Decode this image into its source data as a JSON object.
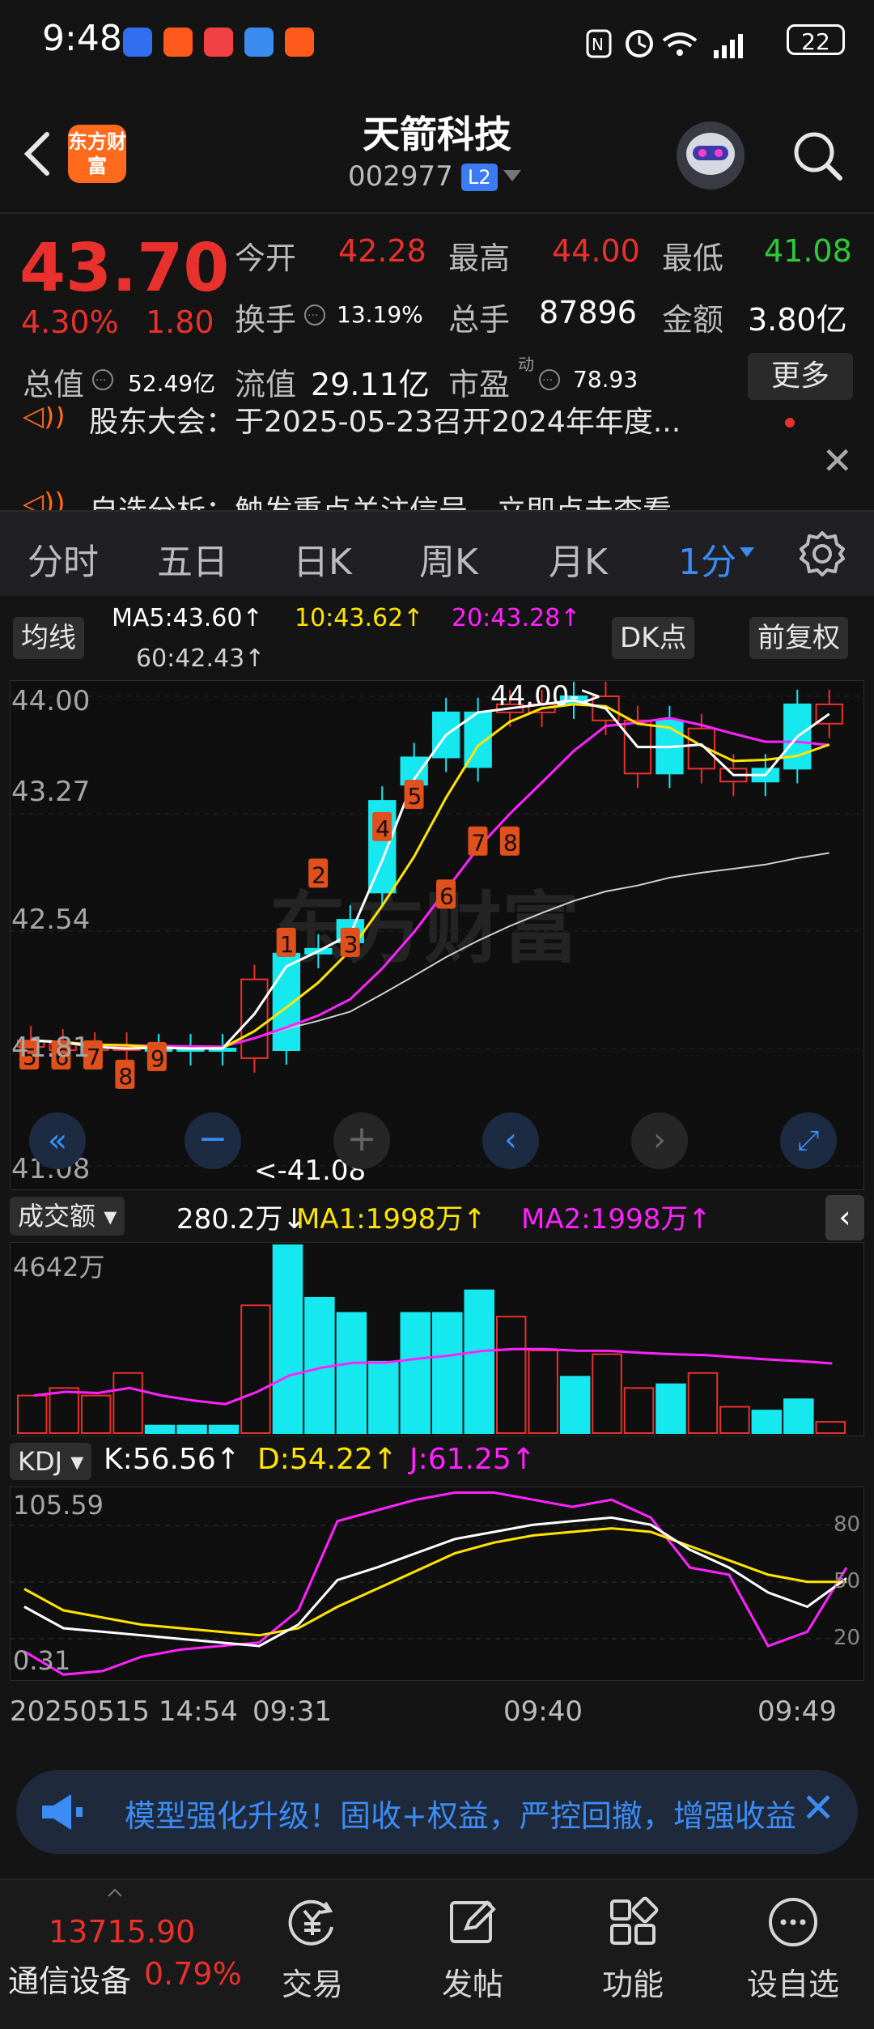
{
  "status_bar": {
    "time": "9:48",
    "battery": "22"
  },
  "header": {
    "back_icon": "chevron-left-icon",
    "logo_text": "东方财富",
    "stock_name": "天箭科技",
    "stock_code": "002977",
    "level_badge": "L2",
    "search_icon": "search-icon"
  },
  "quote": {
    "price": "43.70",
    "change_pct": "4.30%",
    "change_amt": "1.80",
    "open_label": "今开",
    "open_value": "42.28",
    "high_label": "最高",
    "high_value": "44.00",
    "low_label": "最低",
    "low_value": "41.08",
    "turnover_label": "换手",
    "turnover_value": "13.19%",
    "volume_label": "总手",
    "volume_value": "87896",
    "amount_label": "金额",
    "amount_value": "3.80亿",
    "mcap_label": "总值",
    "mcap_value": "52.49亿",
    "float_label": "流值",
    "float_value": "29.11亿",
    "pe_label": "市盈",
    "pe_sup": "动",
    "pe_value": "78.93",
    "more_label": "更多"
  },
  "news": {
    "line1": "股东大会：于2025-05-23召开2024年年度...",
    "line2": "自选分析：触发重点关注信号，立即点击查看"
  },
  "tabs": {
    "items": [
      "分时",
      "五日",
      "日K",
      "周K",
      "月K"
    ],
    "active": "1分"
  },
  "ma": {
    "chip": "均线",
    "ma5": "MA5:43.60↑",
    "ma10": "10:43.62↑",
    "ma20": "20:43.28↑",
    "ma60": "60:42.43↑",
    "dk_label": "DK点",
    "adjust_label": "前复权"
  },
  "kchart": {
    "y_labels": [
      "44.00",
      "43.27",
      "42.54",
      "41.81",
      "41.08"
    ],
    "high_marker": "44.00->",
    "low_marker": "<-41.08",
    "td_labels_red": [
      "1",
      "2",
      "3",
      "4",
      "5",
      "6",
      "7",
      "8"
    ],
    "td_labels_low": [
      "5",
      "6",
      "7",
      "8",
      "9"
    ]
  },
  "volume": {
    "chip": "成交额",
    "current": "280.2万↓",
    "ma1": "MA1:1998万↑",
    "ma2": "MA2:1998万↑",
    "y_top": "4642万"
  },
  "kdj": {
    "chip": "KDJ",
    "k": "K:56.56↑",
    "d": "D:54.22↑",
    "j": "J:61.25↑",
    "y_top": "105.59",
    "y_bottom": "0.31",
    "levels": [
      "80",
      "50",
      "20"
    ]
  },
  "time_axis": {
    "start": "20250515 14:54",
    "t1": "09:31",
    "t2": "09:40",
    "t3": "09:49"
  },
  "banner": {
    "text": "模型强化升级！固收+权益，严控回撤，增强收益"
  },
  "bottom_nav": {
    "index_value": "13715.90",
    "index_name": "通信设备",
    "index_change": "0.79%",
    "items": [
      "交易",
      "发帖",
      "功能",
      "设自选"
    ]
  },
  "chart_data": {
    "type": "candlestick",
    "price_range": [
      41.08,
      44.0
    ],
    "candles": [
      {
        "o": 41.82,
        "c": 41.86,
        "up": false
      },
      {
        "o": 41.8,
        "c": 41.84,
        "up": false
      },
      {
        "o": 41.82,
        "c": 41.8,
        "up": false
      },
      {
        "o": 41.8,
        "c": 41.82,
        "up": false
      },
      {
        "o": 41.81,
        "c": 41.81,
        "up": true
      },
      {
        "o": 41.81,
        "c": 41.81,
        "up": true
      },
      {
        "o": 41.81,
        "c": 41.81,
        "up": true
      },
      {
        "o": 41.75,
        "c": 42.24,
        "up": false
      },
      {
        "o": 41.8,
        "c": 42.4,
        "up": true
      },
      {
        "o": 42.4,
        "c": 42.43,
        "up": true
      },
      {
        "o": 42.47,
        "c": 42.61,
        "up": true
      },
      {
        "o": 42.78,
        "c": 43.35,
        "up": true
      },
      {
        "o": 43.45,
        "c": 43.62,
        "up": true
      },
      {
        "o": 43.62,
        "c": 43.9,
        "up": true
      },
      {
        "o": 43.56,
        "c": 43.9,
        "up": true
      },
      {
        "o": 43.9,
        "c": 43.95,
        "up": false
      },
      {
        "o": 43.9,
        "c": 43.95,
        "up": false
      },
      {
        "o": 43.95,
        "c": 44.0,
        "up": true
      },
      {
        "o": 44.0,
        "c": 43.85,
        "up": false
      },
      {
        "o": 43.85,
        "c": 43.52,
        "up": false
      },
      {
        "o": 43.52,
        "c": 43.85,
        "up": true
      },
      {
        "o": 43.8,
        "c": 43.55,
        "up": false
      },
      {
        "o": 43.55,
        "c": 43.47,
        "up": false
      },
      {
        "o": 43.47,
        "c": 43.55,
        "up": true
      },
      {
        "o": 43.55,
        "c": 43.95,
        "up": true
      },
      {
        "o": 43.95,
        "c": 43.83,
        "up": false
      }
    ],
    "volume_values": [
      20,
      24,
      20,
      32,
      4,
      4,
      4,
      68,
      100,
      72,
      64,
      38,
      64,
      64,
      76,
      62,
      44,
      30,
      42,
      24,
      26,
      32,
      14,
      12,
      18,
      6
    ],
    "kdj": {
      "k": [
        40,
        28,
        26,
        24,
        22,
        20,
        18,
        30,
        55,
        62,
        70,
        78,
        82,
        86,
        88,
        90,
        86,
        72,
        62,
        48,
        40,
        56
      ],
      "d": [
        50,
        38,
        34,
        30,
        28,
        26,
        24,
        28,
        40,
        50,
        60,
        70,
        76,
        80,
        82,
        84,
        82,
        74,
        66,
        58,
        54,
        54
      ],
      "j": [
        15,
        2,
        4,
        12,
        16,
        18,
        20,
        38,
        88,
        94,
        100,
        104,
        104,
        100,
        96,
        100,
        90,
        62,
        58,
        18,
        26,
        62
      ]
    }
  }
}
